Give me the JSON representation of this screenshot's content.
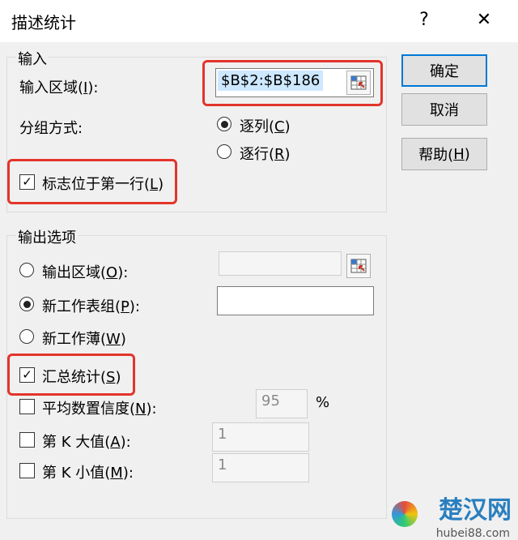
{
  "window": {
    "title": "描述统计",
    "help_glyph": "?",
    "close_glyph": "✕"
  },
  "input_group": {
    "label": "输入",
    "range_label_prefix": "输入区域(",
    "range_label_key": "I",
    "range_label_suffix": "):",
    "range_value": "$B$2:$B$186",
    "grouping_label": "分组方式:",
    "by_column_prefix": "逐列(",
    "by_column_key": "C",
    "by_column_suffix": ")",
    "by_row_prefix": "逐行(",
    "by_row_key": "R",
    "by_row_suffix": ")",
    "labels_first_row_prefix": "标志位于第一行(",
    "labels_first_row_key": "L",
    "labels_first_row_suffix": ")",
    "check_mark": "✓"
  },
  "output_group": {
    "label": "输出选项",
    "output_range_prefix": "输出区域(",
    "output_range_key": "O",
    "output_range_suffix": "):",
    "new_sheet_prefix": "新工作表组(",
    "new_sheet_key": "P",
    "new_sheet_suffix": "):",
    "new_workbook_prefix": "新工作薄(",
    "new_workbook_key": "W",
    "new_workbook_suffix": ")",
    "summary_prefix": "汇总统计(",
    "summary_key": "S",
    "summary_suffix": ")",
    "confidence_prefix": "平均数置信度(",
    "confidence_key": "N",
    "confidence_suffix": "):",
    "confidence_value": "95",
    "percent": "%",
    "kth_largest_prefix": "第 K 大值(",
    "kth_largest_key": "A",
    "kth_largest_suffix": "):",
    "kth_largest_value": "1",
    "kth_smallest_prefix": "第 K 小值(",
    "kth_smallest_key": "M",
    "kth_smallest_suffix": "):",
    "kth_smallest_value": "1",
    "check_mark": "✓"
  },
  "buttons": {
    "ok": "确定",
    "cancel": "取消",
    "help_prefix": "帮助(",
    "help_key": "H",
    "help_suffix": ")"
  },
  "watermark": {
    "text": "楚汉网",
    "sub": "hubei88.com"
  },
  "colors": {
    "highlight": "#e3342b",
    "default_button_border": "#0078d7"
  }
}
